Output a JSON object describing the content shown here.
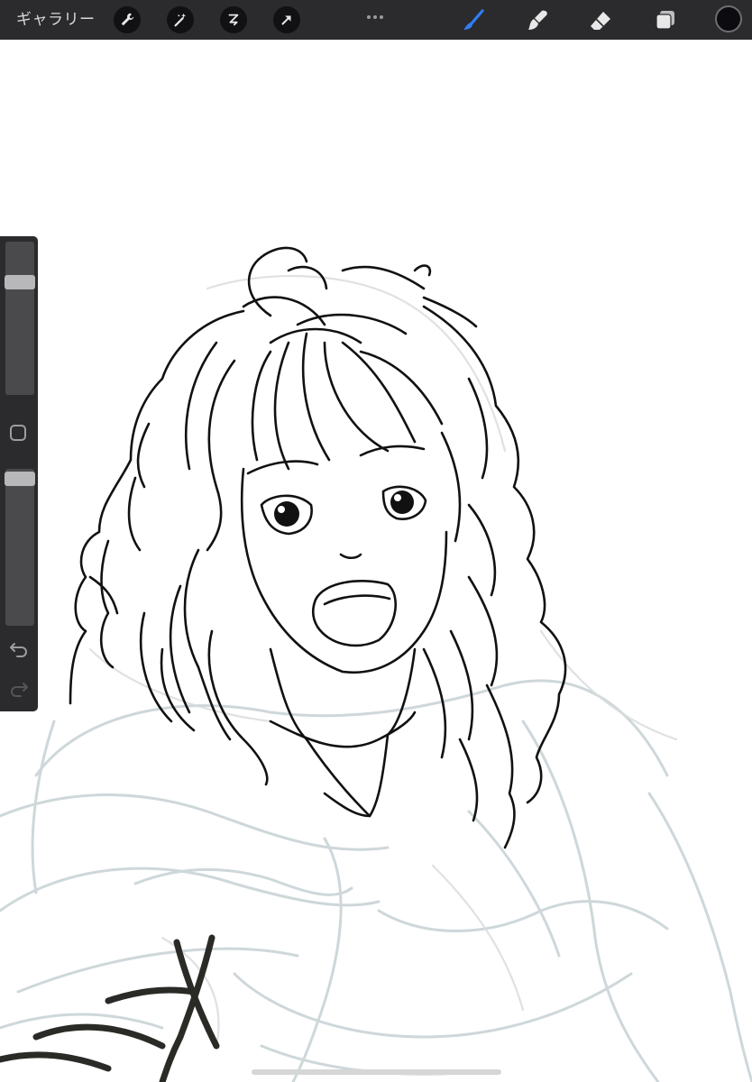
{
  "toolbar": {
    "gallery_label": "ギャラリー",
    "left_tools": [
      "wrench-icon",
      "magic-wand-icon",
      "selection-s-icon",
      "transform-arrow-icon"
    ],
    "right_tools": [
      "brush-icon",
      "smudge-icon",
      "eraser-icon",
      "layers-icon"
    ],
    "active_tool": "brush-icon",
    "active_tool_color": "#2f7df6",
    "current_color": "#0b0b10"
  },
  "sidebar": {
    "brush_size_level": 0.76,
    "opacity_level": 0.98,
    "icons": [
      "modify-square-icon",
      "undo-icon",
      "redo-icon"
    ]
  },
  "canvas": {
    "subject": "line-art-girl-curly-hair",
    "sketch_color": "#c9d3d6",
    "ink_color": "#111111"
  }
}
